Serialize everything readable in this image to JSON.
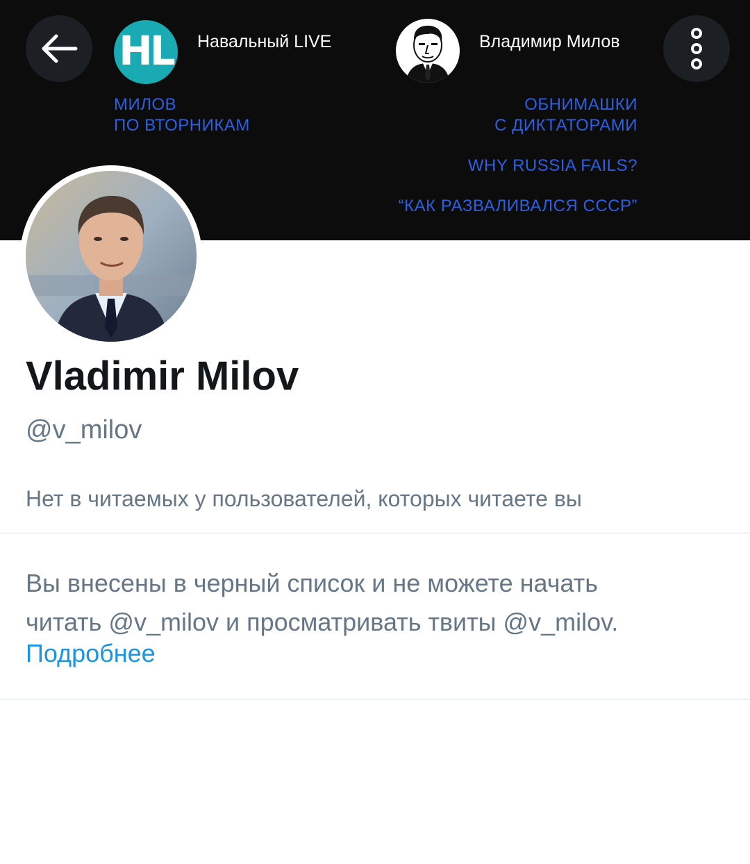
{
  "banner": {
    "left_title": "Навальный LIVE",
    "left_logo_text": "HL",
    "left_subtitle_line1": "МИЛОВ",
    "left_subtitle_line2": "ПО ВТОРНИКАМ",
    "right_title": "Владимир Милов",
    "right_item1_line1": "ОБНИМАШКИ",
    "right_item1_line2": "С ДИКТАТОРАМИ",
    "right_item2": "WHY RUSSIA FAILS?",
    "right_item3": "“КАК РАЗВАЛИВАЛСЯ СССР”",
    "accent_color": "#2d5fe0"
  },
  "toolbar": {
    "back_icon": "arrow-left-icon",
    "more_icon": "more-vertical-icon"
  },
  "profile": {
    "display_name": "Vladimir Milov",
    "handle": "@v_milov",
    "follow_notice": "Нет в читаемых у пользователей, которых читаете вы",
    "blocked_message_line1": "Вы внесены в черный список и не можете начать",
    "blocked_message_line2": "читать @v_milov и просматривать твиты @v_milov.",
    "learn_more": "Подробнее",
    "link_color": "#1b95e0"
  }
}
